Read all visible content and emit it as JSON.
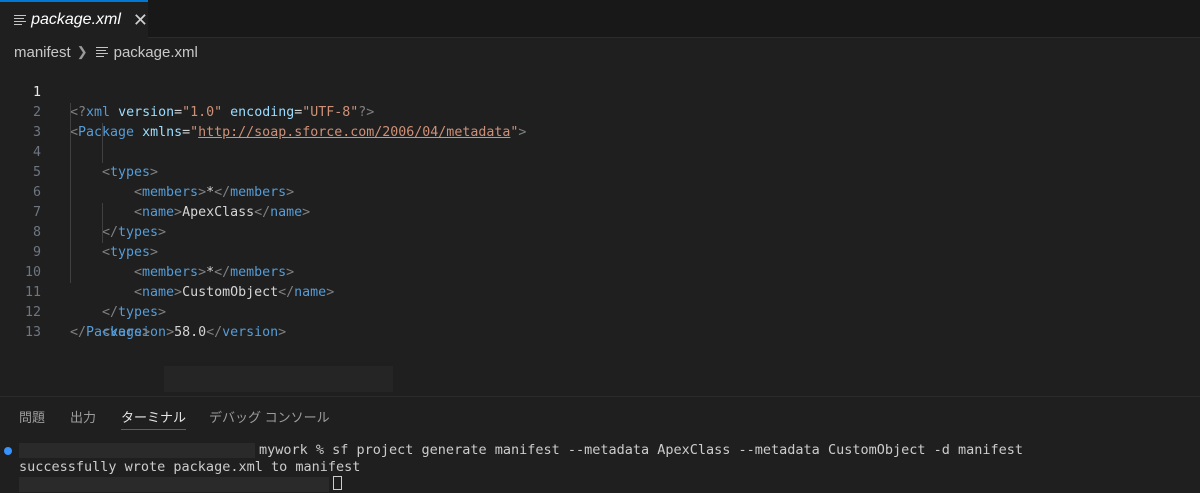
{
  "tab": {
    "title": "package.xml",
    "file_icon": "lines-file-icon",
    "close_icon": "close-icon"
  },
  "breadcrumb": {
    "folder": "manifest",
    "file": "package.xml"
  },
  "editor": {
    "line_numbers": [
      "1",
      "2",
      "3",
      "4",
      "5",
      "6",
      "7",
      "8",
      "9",
      "10",
      "11",
      "12",
      "13"
    ],
    "l1": {
      "open": "<?",
      "tag": "xml",
      "attr1": "version",
      "eq1": "=",
      "val1": "\"1.0\"",
      "attr2": "encoding",
      "eq2": "=",
      "val2": "\"UTF-8\"",
      "close": "?>"
    },
    "l2": {
      "open": "<",
      "tag": "Package",
      "attr": "xmlns",
      "eq": "=",
      "q1": "\"",
      "url": "http://soap.sforce.com/2006/04/metadata",
      "q2": "\"",
      "close": ">"
    },
    "l3": {
      "open": "<",
      "tag": "types",
      "close": ">"
    },
    "l4": {
      "open": "<",
      "tag": "members",
      "close": ">",
      "text": "*",
      "open2": "</",
      "tag2": "members",
      "close2": ">"
    },
    "l5": {
      "open": "<",
      "tag": "name",
      "close": ">",
      "text": "ApexClass",
      "open2": "</",
      "tag2": "name",
      "close2": ">"
    },
    "l6": {
      "open": "</",
      "tag": "types",
      "close": ">"
    },
    "l7": {
      "open": "<",
      "tag": "types",
      "close": ">"
    },
    "l8": {
      "open": "<",
      "tag": "members",
      "close": ">",
      "text": "*",
      "open2": "</",
      "tag2": "members",
      "close2": ">"
    },
    "l9": {
      "open": "<",
      "tag": "name",
      "close": ">",
      "text": "CustomObject",
      "open2": "</",
      "tag2": "name",
      "close2": ">"
    },
    "l10": {
      "open": "</",
      "tag": "types",
      "close": ">"
    },
    "l11": {
      "open": "<",
      "tag": "version",
      "close": ">",
      "text": "58.0",
      "open2": "</",
      "tag2": "version",
      "close2": ">"
    },
    "l12": {
      "open": "</",
      "tag": "Package",
      "close": ">"
    }
  },
  "panel": {
    "tabs": [
      "問題",
      "出力",
      "ターミナル",
      "デバッグ コンソール"
    ],
    "active_tab": "ターミナル"
  },
  "terminal": {
    "command": "mywork % sf project generate manifest --metadata ApexClass --metadata CustomObject -d manifest",
    "output": "successfully wrote package.xml to manifest"
  },
  "colors": {
    "accent": "#0078d4",
    "tag": "#569cd6",
    "attr": "#9cdcfe",
    "string": "#ce9178",
    "bg": "#1f1f1f"
  }
}
